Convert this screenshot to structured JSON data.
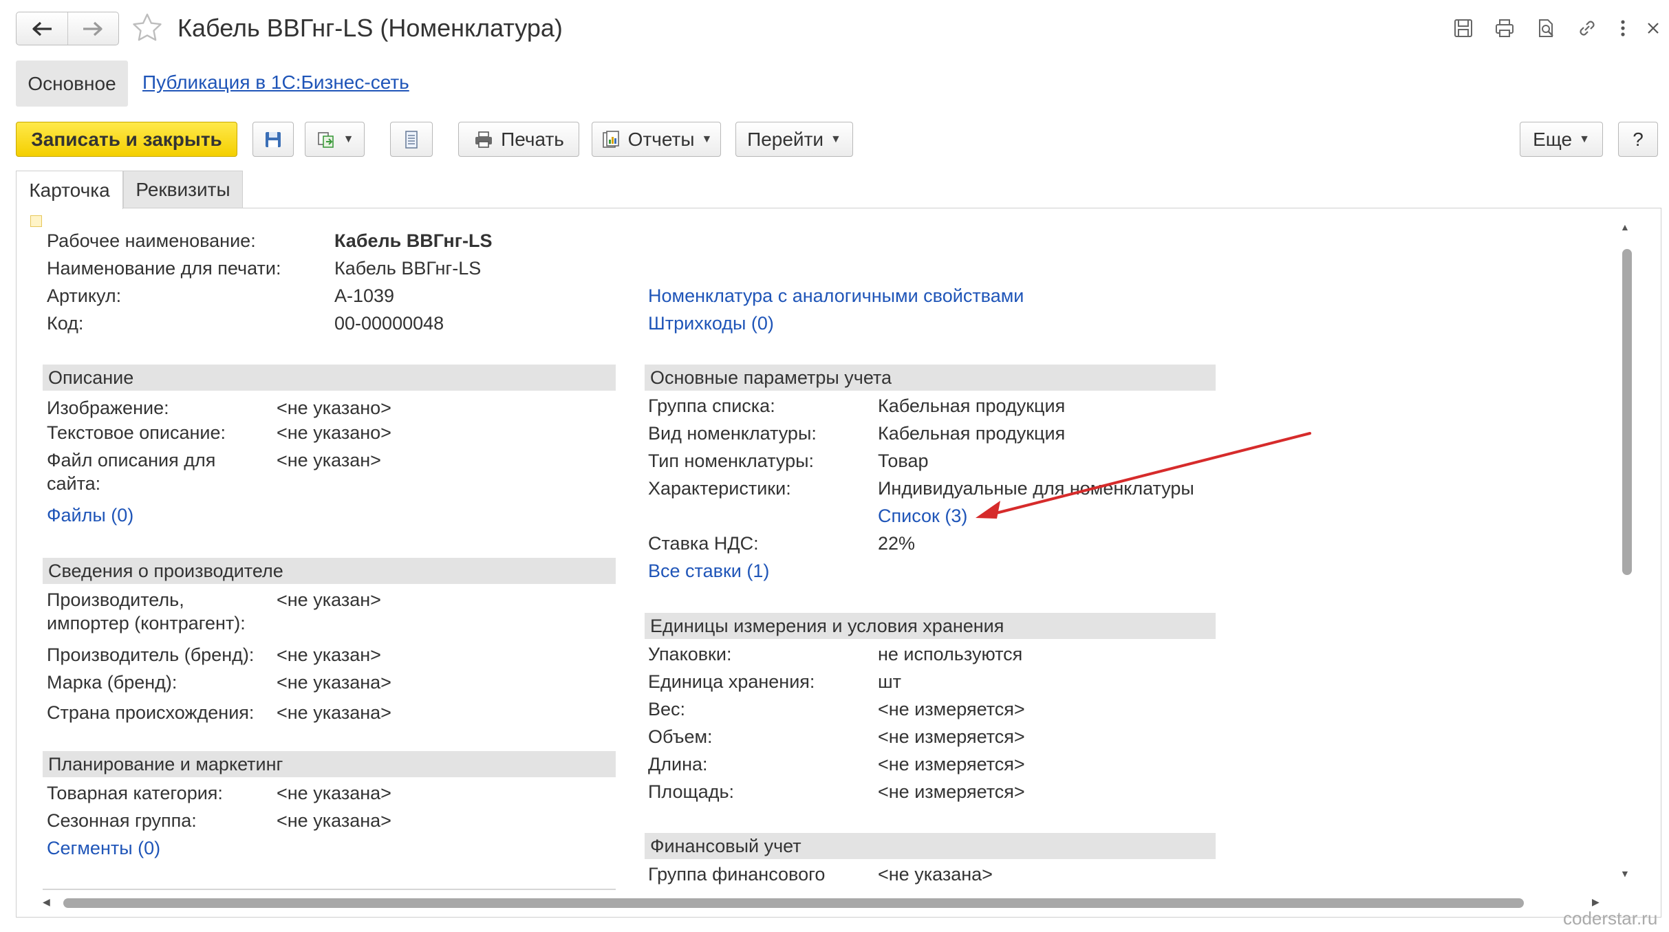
{
  "window": {
    "title": "Кабель ВВГнг-LS (Номенклатура)",
    "nav": {
      "back_icon": "arrow-left-icon",
      "forward_icon": "arrow-right-icon"
    },
    "favorite_icon": "star-icon",
    "actions": [
      "save-icon",
      "print-icon",
      "search-doc-icon",
      "link-icon",
      "more-icon",
      "close-icon"
    ]
  },
  "top_nav": {
    "main": "Основное",
    "link": "Публикация в 1С:Бизнес-сеть"
  },
  "toolbar": {
    "save_close": "Записать и закрыть",
    "print": "Печать",
    "reports": "Отчеты",
    "goto": "Перейти",
    "more": "Еще",
    "help": "?"
  },
  "tabs": [
    "Карточка",
    "Реквизиты"
  ],
  "header_fields": [
    {
      "label": "Рабочее наименование:",
      "value": "Кабель ВВГнг-LS"
    },
    {
      "label": "Наименование для печати:",
      "value": "Кабель ВВГнг-LS"
    },
    {
      "label": "Артикул:",
      "value": "А-1039"
    },
    {
      "label": "Код:",
      "value": "00-00000048"
    }
  ],
  "right_links": [
    "Номенклатура с аналогичными свойствами",
    "Штрихкоды (0)"
  ],
  "left": {
    "description": {
      "title": "Описание",
      "fields": [
        {
          "label": "Изображение:",
          "value": "<не указано>"
        },
        {
          "label": "Текстовое описание:",
          "value": "<не указано>"
        },
        {
          "label_line1": "Файл описания для",
          "label_line2": "сайта:",
          "value": "<не указан>"
        }
      ],
      "link": "Файлы (0)"
    },
    "manufacturer": {
      "title": "Сведения о производителе",
      "fields": [
        {
          "label_line1": "Производитель,",
          "label_line2": "импортер (контрагент):",
          "value": "<не указан>"
        },
        {
          "label": "Производитель (бренд):",
          "value": "<не указан>"
        },
        {
          "label": "Марка (бренд):",
          "value": "<не указана>"
        },
        {
          "label": "Страна происхождения:",
          "value": "<не указана>"
        }
      ]
    },
    "planning": {
      "title": "Планирование и маркетинг",
      "fields": [
        {
          "label": "Товарная категория:",
          "value": "<не указана>"
        },
        {
          "label": "Сезонная группа:",
          "value": "<не указана>"
        }
      ],
      "link": "Сегменты (0)"
    }
  },
  "right": {
    "accounting": {
      "title": "Основные параметры учета",
      "fields": [
        {
          "label": "Группа списка:",
          "value": "Кабельная продукция"
        },
        {
          "label": "Вид номенклатуры:",
          "value": "Кабельная продукция"
        },
        {
          "label": "Тип номенклатуры:",
          "value": "Товар"
        },
        {
          "label": "Характеристики:",
          "value": "Индивидуальные для номенклатуры"
        }
      ],
      "characteristics_link": "Список (3)",
      "vat_label": "Ставка НДС:",
      "vat_value": "22%",
      "all_rates_link": "Все ставки (1)"
    },
    "units": {
      "title": "Единицы измерения и условия хранения",
      "fields": [
        {
          "label": "Упаковки:",
          "value": "не используются"
        },
        {
          "label": "Единица хранения:",
          "value": "шт"
        },
        {
          "label": "Вес:",
          "value": "<не измеряется>"
        },
        {
          "label": "Объем:",
          "value": "<не измеряется>"
        },
        {
          "label": "Длина:",
          "value": "<не измеряется>"
        },
        {
          "label": "Площадь:",
          "value": "<не измеряется>"
        }
      ]
    },
    "finance": {
      "title": "Финансовый учет",
      "fields": [
        {
          "label": "Группа финансового",
          "value": "<не указана>"
        }
      ]
    }
  },
  "annotation": {
    "color": "#d62b2b"
  },
  "watermark": "coderstar.ru"
}
